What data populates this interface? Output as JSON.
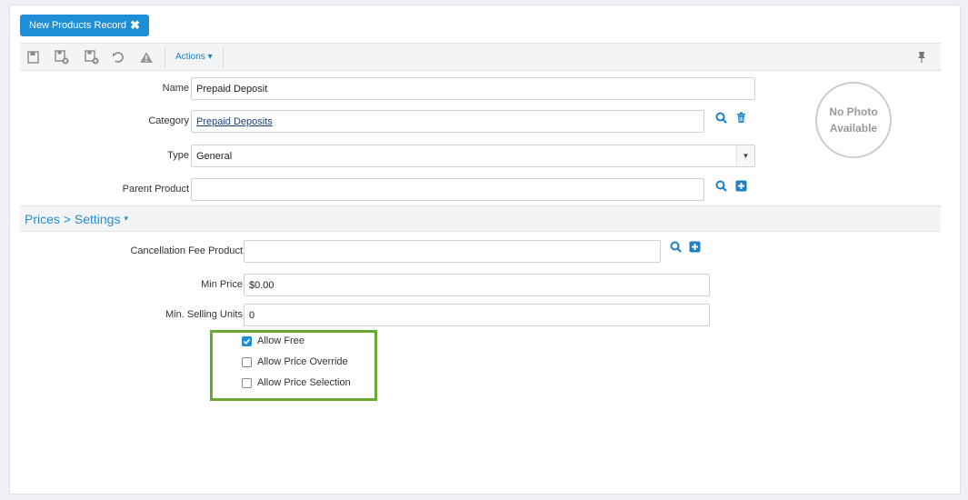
{
  "tab": {
    "title": "New Products Record",
    "close_glyph": "✖"
  },
  "toolbar": {
    "icons": [
      "save-icon",
      "save-close-icon",
      "save-new-icon",
      "undo-icon",
      "warning-icon"
    ],
    "actions_label": "Actions",
    "actions_caret": "▾",
    "pin_icon": "pin-icon"
  },
  "form": {
    "name": {
      "label": "Name",
      "value": "Prepaid Deposit"
    },
    "category": {
      "label": "Category",
      "value": "Prepaid Deposits"
    },
    "type": {
      "label": "Type",
      "value": "General"
    },
    "parent_product": {
      "label": "Parent Product",
      "value": ""
    }
  },
  "photo": {
    "line1": "No Photo",
    "line2": "Available"
  },
  "section": {
    "title": "Prices > Settings",
    "caret": "▾"
  },
  "prices": {
    "cancellation_fee_product": {
      "label": "Cancellation Fee Product",
      "value": ""
    },
    "min_price": {
      "label": "Min Price",
      "value": "$0.00"
    },
    "min_selling_units": {
      "label": "Min. Selling Units",
      "value": "0"
    }
  },
  "checkboxes": [
    {
      "label": "Allow Free",
      "checked": true
    },
    {
      "label": "Allow Price Override",
      "checked": false
    },
    {
      "label": "Allow Price Selection",
      "checked": false
    }
  ],
  "colors": {
    "accent": "#1e8fd6",
    "highlight": "#6aa834",
    "section_text": "#2a8ccd"
  }
}
